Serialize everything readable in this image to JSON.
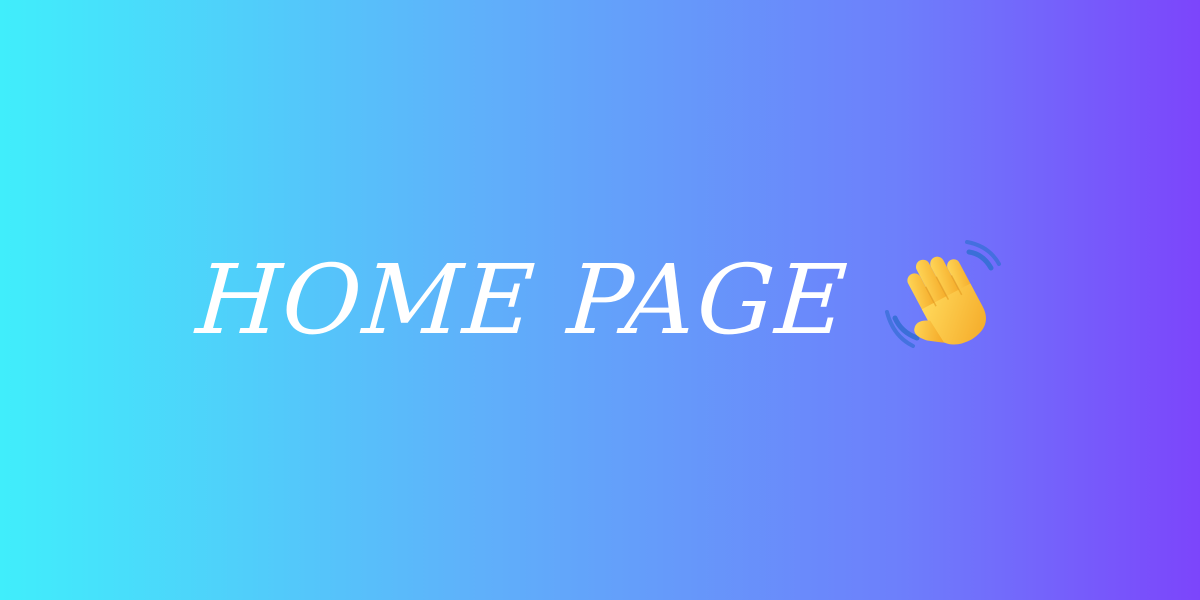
{
  "banner": {
    "title": "HOME PAGE",
    "icon": "waving-hand-icon",
    "colors": {
      "gradient_start": "#40eefb",
      "gradient_end": "#7c45fb",
      "text": "#ffffff",
      "hand": "#fbc02d"
    }
  }
}
